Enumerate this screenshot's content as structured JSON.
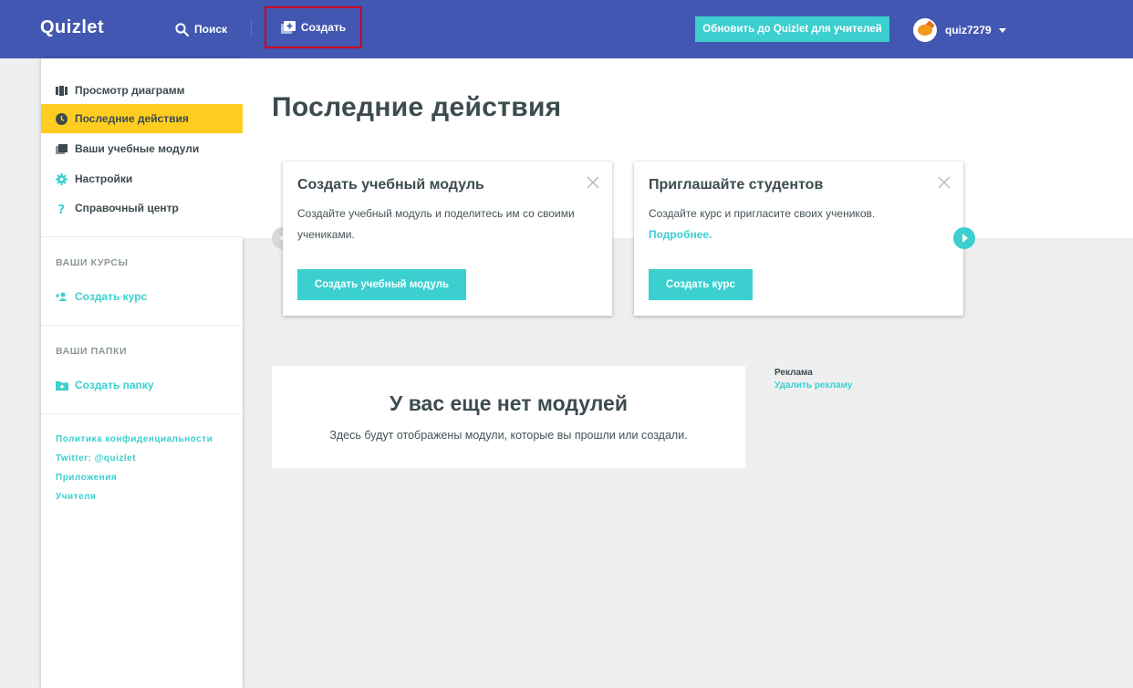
{
  "header": {
    "logo": "Quizlet",
    "search_label": "Поиск",
    "create_label": "Создать",
    "upgrade_label": "Обновить до Quizlet для учителей",
    "username": "quiz7279"
  },
  "sidebar": {
    "items": [
      {
        "label": "Просмотр диаграмм",
        "icon": "diagram-icon"
      },
      {
        "label": "Последние действия",
        "icon": "clock-icon",
        "active": true
      },
      {
        "label": "Ваши учебные модули",
        "icon": "modules-icon"
      },
      {
        "label": "Настройки",
        "icon": "gear-icon"
      },
      {
        "label": "Справочный центр",
        "icon": "help-icon"
      }
    ],
    "courses_heading": "ВАШИ КУРСЫ",
    "create_course_label": "Создать курс",
    "folders_heading": "ВАШИ ПАПКИ",
    "create_folder_label": "Создать папку",
    "footer_links": [
      "Политика конфиденциальности",
      "Twitter: @quizlet",
      "Приложения",
      "Учителя"
    ]
  },
  "main": {
    "title": "Последние действия",
    "cards": [
      {
        "title": "Создать учебный модуль",
        "text": "Создайте учебный модуль и поделитесь им со своими учениками.",
        "button": "Создать учебный модуль"
      },
      {
        "title": "Приглашайте студентов",
        "text": "Создайте курс и пригласите своих учеников.",
        "link": "Подробнее.",
        "button": "Создать курс"
      }
    ],
    "empty_title": "У вас еще нет модулей",
    "empty_text": "Здесь будут отображены модули, которые вы прошли или создали."
  },
  "ad": {
    "label": "Реклама",
    "remove_label": "Удалить рекламу"
  },
  "colors": {
    "header": "#4257b2",
    "accent": "#3ccfcf",
    "active": "#ffcd1f",
    "highlight_border": "#d0021b"
  }
}
